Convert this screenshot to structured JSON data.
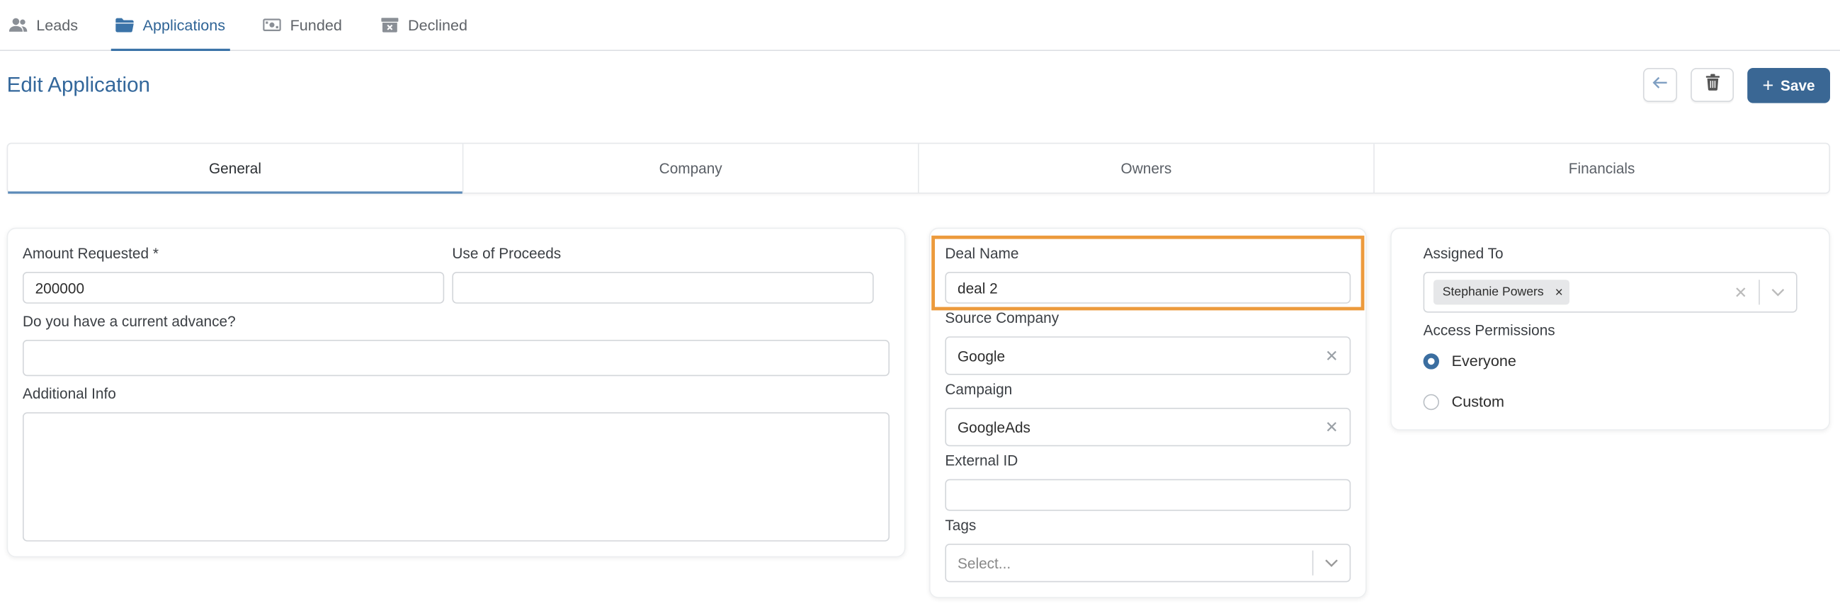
{
  "nav": {
    "tabs": [
      {
        "label": "Leads",
        "icon": "users-icon"
      },
      {
        "label": "Applications",
        "icon": "folder-icon"
      },
      {
        "label": "Funded",
        "icon": "money-icon"
      },
      {
        "label": "Declined",
        "icon": "archive-x-icon"
      }
    ],
    "active": "Applications"
  },
  "page": {
    "title": "Edit Application",
    "actions": {
      "back_icon": "arrow-left-icon",
      "delete_icon": "trash-icon",
      "save_label": "Save"
    }
  },
  "section_tabs": [
    "General",
    "Company",
    "Owners",
    "Financials"
  ],
  "general": {
    "amount_requested": {
      "label": "Amount Requested *",
      "value": "200000"
    },
    "use_of_proceeds": {
      "label": "Use of Proceeds",
      "value": ""
    },
    "current_advance": {
      "label": "Do you have a current advance?",
      "value": ""
    },
    "additional_info": {
      "label": "Additional Info",
      "value": ""
    }
  },
  "deal": {
    "deal_name": {
      "label": "Deal Name",
      "value": "deal 2"
    },
    "source_company": {
      "label": "Source Company",
      "value": "Google"
    },
    "campaign": {
      "label": "Campaign",
      "value": "GoogleAds"
    },
    "external_id": {
      "label": "External ID",
      "value": ""
    },
    "tags": {
      "label": "Tags",
      "placeholder": "Select..."
    }
  },
  "assignment": {
    "assigned_to": {
      "label": "Assigned To",
      "chips": [
        "Stephanie Powers"
      ]
    },
    "access_permissions": {
      "label": "Access Permissions",
      "options": [
        {
          "label": "Everyone",
          "selected": true
        },
        {
          "label": "Custom",
          "selected": false
        }
      ]
    }
  },
  "colors": {
    "accent": "#3a6794",
    "highlight": "#ec9a3c"
  }
}
